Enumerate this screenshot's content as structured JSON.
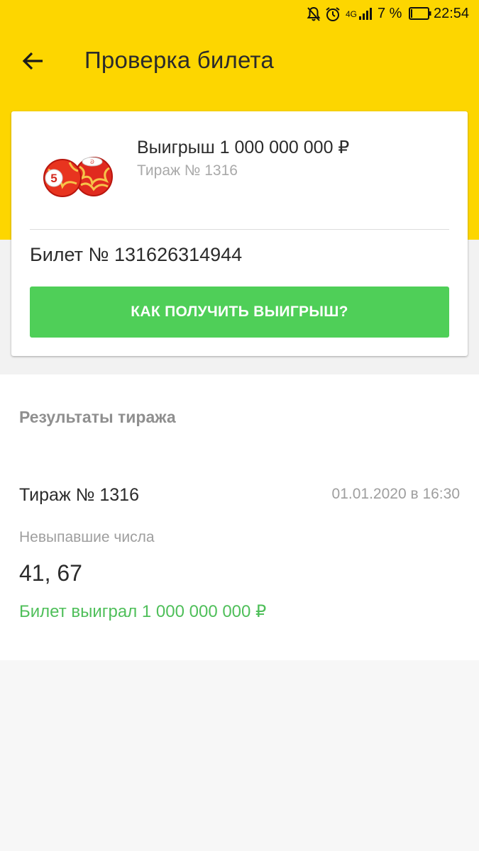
{
  "status_bar": {
    "network": "4G",
    "battery": "7 %",
    "time": "22:54",
    "icons": [
      "mute-icon",
      "alarm-icon",
      "signal-icon",
      "battery-icon"
    ]
  },
  "toolbar": {
    "back_icon": "arrow-left-icon",
    "title": "Проверка билета"
  },
  "ticket_card": {
    "prize": "Выигрыш 1 000 000 000 ₽",
    "draw": "Тираж № 1316",
    "ticket_number": "Билет № 131626314944",
    "button_label": "КАК ПОЛУЧИТЬ ВЫИГРЫШ?",
    "image_icon": "lotto-barrels-icon",
    "barrel_number": "5"
  },
  "results": {
    "heading": "Результаты тиража",
    "draw_name": "Тираж № 1316",
    "draw_date": "01.01.2020 в 16:30",
    "missing_label": "Невыпавшие числа",
    "missing_numbers": "41, 67",
    "won_text": "Билет выиграл 1 000 000 000 ₽"
  },
  "colors": {
    "header": "#fdd600",
    "button": "#4fcf58",
    "won_text": "#4fbf5a"
  }
}
